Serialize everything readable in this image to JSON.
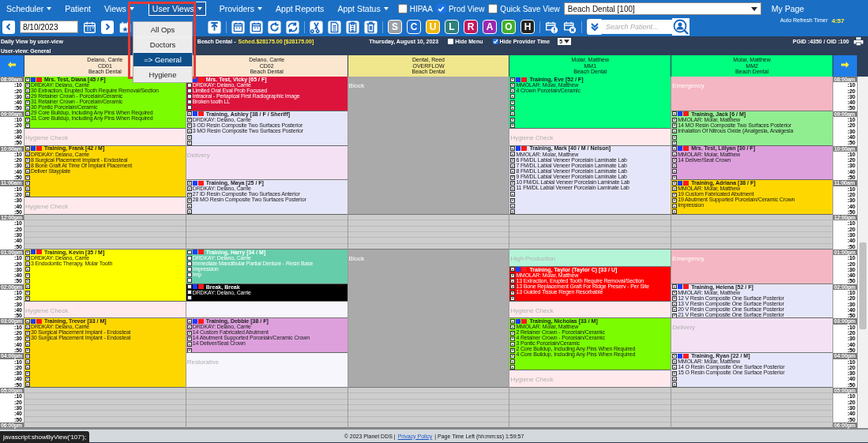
{
  "nav": {
    "items": [
      {
        "label": "Scheduler",
        "caret": true,
        "selected": false
      },
      {
        "label": "Patient",
        "caret": false,
        "selected": false
      },
      {
        "label": "Views",
        "caret": true,
        "selected": false
      },
      {
        "label": "User Views",
        "caret": true,
        "selected": true
      },
      {
        "label": "Providers",
        "caret": true,
        "selected": false
      },
      {
        "label": "Appt Reports",
        "caret": false,
        "selected": false
      },
      {
        "label": "Appt Status",
        "caret": true,
        "selected": false
      }
    ],
    "toggles": [
      {
        "label": "HIPAA",
        "checked": false
      },
      {
        "label": "Prod View",
        "checked": true
      },
      {
        "label": "Quick Save View",
        "checked": false
      }
    ],
    "office_select": "Beach Dental [100]",
    "my_page": "My Page"
  },
  "user_views_menu": [
    {
      "label": "All Ops",
      "selected": false
    },
    {
      "label": "Doctors",
      "selected": false
    },
    {
      "label": "=> General",
      "selected": true
    },
    {
      "label": "Hygiene",
      "selected": false
    }
  ],
  "refresh": {
    "label": "Auto Refresh Timer",
    "value": "4:57"
  },
  "toolbar": {
    "date": "8/10/2023",
    "search_placeholder": "Search Patient...",
    "letters": [
      {
        "label": "S",
        "color": "#9aa0a6"
      },
      {
        "label": "C",
        "color": "#1e6fd0"
      },
      {
        "label": "U",
        "color": "#f2b705"
      },
      {
        "label": "L",
        "color": "#2f7f7a"
      },
      {
        "label": "R",
        "color": "#c2185b"
      },
      {
        "label": "A",
        "color": "#9c27b0"
      },
      {
        "label": "O",
        "color": "#43b02a"
      },
      {
        "label": "H",
        "color": "#222222"
      }
    ]
  },
  "info": {
    "view_caption": "Daily View by user-view",
    "office": "Beach Dental -",
    "schedule": "Sched.$28175.00 [$28175.00]",
    "date": "Thursday, August 10, 2023",
    "hide_menu": {
      "label": "Hide Menu",
      "checked": false
    },
    "hide_provider_time": {
      "label": "Hide Provider Time",
      "checked": true
    },
    "interval": "5",
    "ids": "PGID :4350 / OID :100",
    "user_view": "User-view: General"
  },
  "columns": [
    {
      "provider": "Delano, Carrie",
      "op": "CD01",
      "office": "Beach Dental",
      "color": "#fbe7cf"
    },
    {
      "provider": "Delano, Carrie",
      "op": "CD02",
      "office": "Beach Dental",
      "color": "#fbe7cf"
    },
    {
      "provider": "Dental, Reed",
      "op": "OVERFLOW",
      "office": "Beach Dental",
      "color": "#f0e68c"
    },
    {
      "provider": "Molar, Matthew",
      "op": "MM1",
      "office": "Beach Dental",
      "color": "#00ff7f"
    },
    {
      "provider": "Molar, Matthew",
      "op": "MM2",
      "office": "Beach Dental",
      "color": "#00ff7f"
    }
  ],
  "schedule_rows": [
    {
      "kind": "hour",
      "time": "08:00am",
      "time_right": "08:00am",
      "cells": [
        {
          "kind": "appointment",
          "color": "#7cfc00",
          "inverse": false,
          "marked": true,
          "title": "Mrs. Test, Diana [45 / F]",
          "lines": [
            "DRDKAY: Delano, Carrie",
            "30 Extraction, Erupted Tooth Require Removal/Section",
            "29 Retainer Crown - Porcelain/Ceramic",
            "31 Retainer Crown - Porcelain/Ceramic",
            "30 Pontic Porcelain/Ceramic",
            "29 Core Buildup, Including Any Pins When Required",
            "31 Core Buildup, Including Any Pins When Required"
          ]
        },
        {
          "kind": "appointment",
          "color": "#dc143c",
          "inverse": true,
          "marked": false,
          "title": "Mrs. Test, Vicky [65 / F]",
          "lines": [
            "DRDKAY: Delano, Carrie",
            "Limited Oral Eval Prob Focused",
            "Intraoral - Periapical First Radiographic Image",
            "Broken tooth LL"
          ]
        },
        {
          "kind": "reserve",
          "color": "#aaaaaa",
          "inverse": true,
          "label": "Block"
        },
        {
          "kind": "appointment",
          "color": "#00ff7f",
          "inverse": false,
          "marked": true,
          "title": "Training, Eve [52 / F]",
          "lines": [
            "MMOLAR: Molar, Matthew",
            "4 Crown Porcelain/Ceramic"
          ]
        },
        {
          "kind": "reserve",
          "color": "#f4b6c2",
          "inverse": true,
          "label": "Emergency"
        }
      ]
    },
    {
      "kind": "minute",
      "time": ":10",
      "time_right": ":10"
    },
    {
      "kind": "minute",
      "time": ":20",
      "time_right": ":20"
    },
    {
      "kind": "minute",
      "time": ":30",
      "time_right": ":30"
    },
    {
      "kind": "minute",
      "time": ":40",
      "time_right": ":40"
    },
    {
      "kind": "minute",
      "time": ":50",
      "time_right": ":50"
    },
    {
      "kind": "hour",
      "time": "09:00am",
      "time_right": "09:00am",
      "cells": [
        {
          "kind": "continued"
        },
        {
          "kind": "appointment",
          "color": "#e6e6fa",
          "inverse": false,
          "marked": true,
          "title": "Training, Ashley [38 / F / Sheriff]",
          "lines": [
            "DRDKAY: Delano, Carrie",
            "3 OD Resin Composite Two Surfaces Posterior",
            "3 MO Resin Composite Two Surfaces Posterior"
          ]
        },
        {
          "kind": "continued"
        },
        {
          "kind": "continued"
        },
        {
          "kind": "appointment",
          "color": "#90ee90",
          "inverse": false,
          "marked": true,
          "title": "Training, Jack [6 / M]",
          "lines": [
            "MMOLAR: Molar, Matthew",
            "14 MO Resin Composite Two Surfaces Posterior",
            "Inhalation Of Nitrous Oxide (Analgesia, Analgesia"
          ]
        }
      ]
    },
    {
      "kind": "minute",
      "time": ":10",
      "time_right": ":10"
    },
    {
      "kind": "minute",
      "time": ":20",
      "time_right": ":20"
    },
    {
      "kind": "minute",
      "time": ":30",
      "time_right": ":30",
      "cells": [
        {
          "kind": "reserve",
          "color": "#ffe9ec",
          "inverse": false,
          "label": "Hygiene Check"
        },
        {
          "kind": "continued"
        },
        {
          "kind": "continued"
        },
        {
          "kind": "reserve",
          "color": "#ffe9ec",
          "inverse": false,
          "label": "Hygiene Check"
        },
        {
          "kind": "continued"
        }
      ]
    },
    {
      "kind": "minute",
      "time": ":40",
      "time_right": ":40"
    },
    {
      "kind": "minute",
      "time": ":50",
      "time_right": ":50"
    },
    {
      "kind": "hour",
      "time": "10:00am",
      "time_right": "10:00am",
      "cells": [
        {
          "kind": "appointment",
          "color": "#ffd700",
          "inverse": false,
          "marked": true,
          "title": "Training, Frank [42 / M]",
          "lines": [
            "DRDKAY: Delano, Carrie",
            "8 Surgical Placement Implant - Endosteal",
            "8 Bone Graft At Time Of Implant Placement",
            "Deliver Stayplate"
          ]
        },
        {
          "kind": "reserve",
          "color": "#f4e2f4",
          "inverse": false,
          "label": "Delivery"
        },
        {
          "kind": "continued"
        },
        {
          "kind": "appointment",
          "color": "#e6e6fa",
          "inverse": false,
          "marked": true,
          "title": "Training, Mark [40 / M / Nelson]",
          "lines": [
            "MMOLAR: Molar, Matthew",
            "6 FM/DL Labial Veneer Porcelain Laminate Lab",
            "7 FM/DL Labial Veneer Porcelain Laminate Lab",
            "8 FM/DL Labial Veneer Porcelain Laminate Lab",
            "9 FM/DL Labial Veneer Porcelain Laminate Lab",
            "10 FM/DL Labial Veneer Porcelain Laminate Lab",
            "11 FM/DL Labial Veneer Porcelain Laminate Lab"
          ]
        },
        {
          "kind": "appointment",
          "color": "#dda0dd",
          "inverse": false,
          "marked": true,
          "title": "Mrs. Test, Lillyan [30 / F]",
          "lines": [
            "MMOLAR: Molar, Matthew",
            "14 Deliver/Seat Crown"
          ]
        }
      ]
    },
    {
      "kind": "minute",
      "time": ":10",
      "time_right": ":10"
    },
    {
      "kind": "minute",
      "time": ":20",
      "time_right": ":20"
    },
    {
      "kind": "minute",
      "time": ":30",
      "time_right": ":30"
    },
    {
      "kind": "minute",
      "time": ":40",
      "time_right": ":40"
    },
    {
      "kind": "minute",
      "time": ":50",
      "time_right": ":50"
    },
    {
      "kind": "hour",
      "time": "11:00am",
      "time_right": "11:00am",
      "cells": [
        {
          "kind": "continued"
        },
        {
          "kind": "appointment",
          "color": "#e6e6fa",
          "inverse": false,
          "marked": true,
          "title": "Training, Maya [25 / F]",
          "lines": [
            "DRDKAY: Delano, Carrie",
            "27 ID Resin Composite Two Surfaces Anterior",
            "28 MO Resin Composite Two Surfaces Posterior"
          ]
        },
        {
          "kind": "continued"
        },
        {
          "kind": "continued"
        },
        {
          "kind": "appointment",
          "color": "#ffd700",
          "inverse": false,
          "marked": true,
          "title": "Training, Adriana [38 / F]",
          "lines": [
            "MMOLAR: Molar, Matthew",
            "19 Custom Fabricated Abutment",
            "19 Abutment Supported Porcelain/Ceramic Crown",
            "Impression"
          ]
        }
      ]
    },
    {
      "kind": "minute",
      "time": ":10",
      "time_right": ":10"
    },
    {
      "kind": "minute",
      "time": ":20",
      "time_right": ":20"
    },
    {
      "kind": "minute",
      "time": ":30",
      "time_right": ":30",
      "cells": [
        {
          "kind": "reserve",
          "color": "#ffe9ec",
          "inverse": false,
          "label": "Hygiene Check"
        },
        {
          "kind": "continued"
        },
        {
          "kind": "continued"
        },
        {
          "kind": "continued"
        },
        {
          "kind": "continued"
        }
      ]
    },
    {
      "kind": "minute",
      "time": ":40",
      "time_right": ":40"
    },
    {
      "kind": "minute",
      "time": ":50",
      "time_right": ":50"
    },
    {
      "kind": "hour",
      "time": "12:00pm",
      "time_right": "12:00pm",
      "cells": [
        {
          "kind": "free"
        },
        {
          "kind": "free"
        },
        {
          "kind": "free"
        },
        {
          "kind": "free"
        },
        {
          "kind": "free"
        }
      ]
    },
    {
      "kind": "minute",
      "time": ":10",
      "time_right": ":10"
    },
    {
      "kind": "minute",
      "time": ":20",
      "time_right": ":20"
    },
    {
      "kind": "minute",
      "time": ":30",
      "time_right": ":30"
    },
    {
      "kind": "minute",
      "time": ":40",
      "time_right": ":40"
    },
    {
      "kind": "minute",
      "time": ":50",
      "time_right": ":50"
    },
    {
      "kind": "hour",
      "time": "01:00pm",
      "time_right": "01:00pm",
      "cells": [
        {
          "kind": "appointment",
          "color": "#ffff00",
          "inverse": false,
          "marked": true,
          "title": "Training, Kevin [35 / M]",
          "lines": [
            "DRDKAY: Delano, Carrie",
            "3 Endodontic Therapy, Molar Tooth"
          ]
        },
        {
          "kind": "appointment",
          "color": "#66cdaa",
          "inverse": true,
          "marked": false,
          "title": "Training, Harry [34 / M]",
          "lines": [
            "DRDKAY: Delano, Carrie",
            "Immediate Mandibular Partial Denture - Resin Base",
            "Impression",
            "Imp"
          ]
        },
        {
          "kind": "reserve",
          "color": "#aaaaaa",
          "inverse": true,
          "label": "Block"
        },
        {
          "kind": "reserve",
          "color": "#b4f5d8",
          "inverse": false,
          "label": "High Production"
        },
        {
          "kind": "reserve",
          "color": "#f4b6c2",
          "inverse": true,
          "label": "Emergency"
        }
      ]
    },
    {
      "kind": "minute",
      "time": ":10",
      "time_right": ":10"
    },
    {
      "kind": "minute",
      "time": ":20",
      "time_right": ":20"
    },
    {
      "kind": "minute",
      "time": ":30",
      "time_right": ":30",
      "cells": [
        {
          "kind": "continued"
        },
        {
          "kind": "continued"
        },
        {
          "kind": "continued"
        },
        {
          "kind": "appointment",
          "color": "#ff0000",
          "inverse": true,
          "marked": true,
          "title": "Training, Taylor (Taylor C) [33 / U]",
          "lines": [
            "MMOLAR: Molar, Matthew",
            "13 Extraction, Erupted Tooth Require Removal/Section",
            "13 Bone Replacement Graft For Ridge Preserv - Per Site",
            "13 Guided Tissue Regen Resorbable"
          ]
        },
        {
          "kind": "continued"
        }
      ]
    },
    {
      "kind": "minute",
      "time": ":40",
      "time_right": ":40"
    },
    {
      "kind": "minute",
      "time": ":50",
      "time_right": ":50"
    },
    {
      "kind": "hour",
      "time": "02:00pm",
      "time_right": "02:00pm",
      "cells": [
        {
          "kind": "continued"
        },
        {
          "kind": "appointment",
          "color": "#000000",
          "inverse": true,
          "marked": false,
          "title": "Break, Break",
          "lines": [
            "DRDKAY: Delano, Carrie"
          ]
        },
        {
          "kind": "continued"
        },
        {
          "kind": "continued"
        },
        {
          "kind": "appointment",
          "color": "#e6e6fa",
          "inverse": false,
          "marked": true,
          "title": "Training, Helena [52 / F]",
          "lines": [
            "MMOLAR: Molar, Matthew",
            "12 V Resin Composite One Surface Posterior",
            "13 V Resin Composite One Surface Posterior",
            "20 V Resin Composite One Surface Posterior",
            "21 V Resin Composite One Surface Posterior"
          ]
        }
      ]
    },
    {
      "kind": "minute",
      "time": ":10",
      "time_right": ":10"
    },
    {
      "kind": "minute",
      "time": ":20",
      "time_right": ":20"
    },
    {
      "kind": "minute",
      "time": ":30",
      "time_right": ":30",
      "cells": [
        {
          "kind": "reserve",
          "color": "#ffe9ec",
          "inverse": false,
          "label": "Hygiene Check"
        },
        {
          "kind": "reserve",
          "color": "#f6f6fc"
        },
        {
          "kind": "continued"
        },
        {
          "kind": "reserve",
          "color": "#ffe9ec",
          "inverse": false,
          "label": "Hygiene Check"
        },
        {
          "kind": "continued"
        }
      ]
    },
    {
      "kind": "minute",
      "time": ":40",
      "time_right": ":40"
    },
    {
      "kind": "minute",
      "time": ":50",
      "time_right": ":50"
    },
    {
      "kind": "hour",
      "time": "03:00pm",
      "time_right": "03:00pm",
      "cells": [
        {
          "kind": "appointment",
          "color": "#ffd700",
          "inverse": false,
          "marked": true,
          "title": "Training, Trevor [33 / M]",
          "lines": [
            "DRDKAY: Delano, Carrie",
            "30 Surgical Placement Implant - Endosteal",
            "30 Surgical Placement Implant - Endosteal"
          ]
        },
        {
          "kind": "appointment",
          "color": "#dda0dd",
          "inverse": false,
          "marked": true,
          "title": "Training, Debbie [38 / F]",
          "lines": [
            "DRDKAY: Delano, Carrie",
            "14 Custom Fabricated Abutment",
            "14 Abutment Supported Porcelain/Ceramic Crown",
            "14 Deliver/Seat Crown"
          ]
        },
        {
          "kind": "continued"
        },
        {
          "kind": "appointment",
          "color": "#7cfc00",
          "inverse": false,
          "marked": true,
          "title": "Training, Nicholas [33 / M]",
          "lines": [
            "MMOLAR: Molar, Matthew",
            "2 Retainer Crown - Porcelain/Ceramic",
            "4 Retainer Crown - Porcelain/Ceramic",
            "3 Pontic Porcelain/Ceramic",
            "2 Core Buildup, Including Any Pins When Required",
            "4 Core Buildup, Including Any Pins When Required"
          ]
        },
        {
          "kind": "reserve",
          "color": "#f4e2f4",
          "inverse": false,
          "label": "Delivery"
        }
      ]
    },
    {
      "kind": "minute",
      "time": ":10",
      "time_right": ":10"
    },
    {
      "kind": "minute",
      "time": ":20",
      "time_right": ":20"
    },
    {
      "kind": "minute",
      "time": ":30",
      "time_right": ":30"
    },
    {
      "kind": "minute",
      "time": ":40",
      "time_right": ":40"
    },
    {
      "kind": "minute",
      "time": ":50",
      "time_right": ":50"
    },
    {
      "kind": "hour",
      "time": "04:00pm",
      "time_right": "04:00pm",
      "cells": [
        {
          "kind": "continued"
        },
        {
          "kind": "reserve",
          "color": "#f6f6fc",
          "inverse": false,
          "label": "Restorative"
        },
        {
          "kind": "continued"
        },
        {
          "kind": "continued"
        },
        {
          "kind": "appointment",
          "color": "#e6e6fa",
          "inverse": false,
          "marked": true,
          "title": "Training, Ryan [22 / M]",
          "lines": [
            "MMOLAR: Molar, Matthew",
            "14 O Resin Composite One Surface Posterior",
            "15 O Resin Composite One Surface Posterior"
          ]
        }
      ]
    },
    {
      "kind": "minute",
      "time": ":10",
      "time_right": ":10"
    },
    {
      "kind": "minute",
      "time": ":20",
      "time_right": ":20"
    },
    {
      "kind": "minute",
      "time": ":30",
      "time_right": ":30",
      "cells": [
        {
          "kind": "continued"
        },
        {
          "kind": "continued"
        },
        {
          "kind": "continued"
        },
        {
          "kind": "reserve",
          "color": "#ffe9ec",
          "inverse": false,
          "label": "Hygiene Check"
        },
        {
          "kind": "continued"
        }
      ]
    },
    {
      "kind": "minute",
      "time": ":40",
      "time_right": ":40"
    },
    {
      "kind": "minute",
      "time": ":50",
      "time_right": ":50"
    },
    {
      "kind": "hour",
      "time": "05:00pm",
      "time_right": "05:00pm",
      "cells": [
        {
          "kind": "free"
        },
        {
          "kind": "free"
        },
        {
          "kind": "free"
        },
        {
          "kind": "free"
        },
        {
          "kind": "free"
        }
      ]
    },
    {
      "kind": "minute",
      "time": ":10",
      "time_right": ":10"
    },
    {
      "kind": "minute",
      "time": ":20",
      "time_right": ":20"
    },
    {
      "kind": "minute",
      "time": ":30",
      "time_right": ":30"
    },
    {
      "kind": "minute",
      "time": ":40",
      "time_right": ":40"
    },
    {
      "kind": "minute",
      "time": ":50",
      "time_right": ":50"
    },
    {
      "kind": "hour",
      "time": "06:00pm",
      "time_right": "06:00pm"
    }
  ],
  "footer": {
    "copyright": "© 2023 Planet DDS |",
    "link": "Privacy Policy",
    "timer": "| Page Time Left (hh:mm:ss) 1:59:57"
  },
  "status_tip": "javascript:showByView('107');"
}
